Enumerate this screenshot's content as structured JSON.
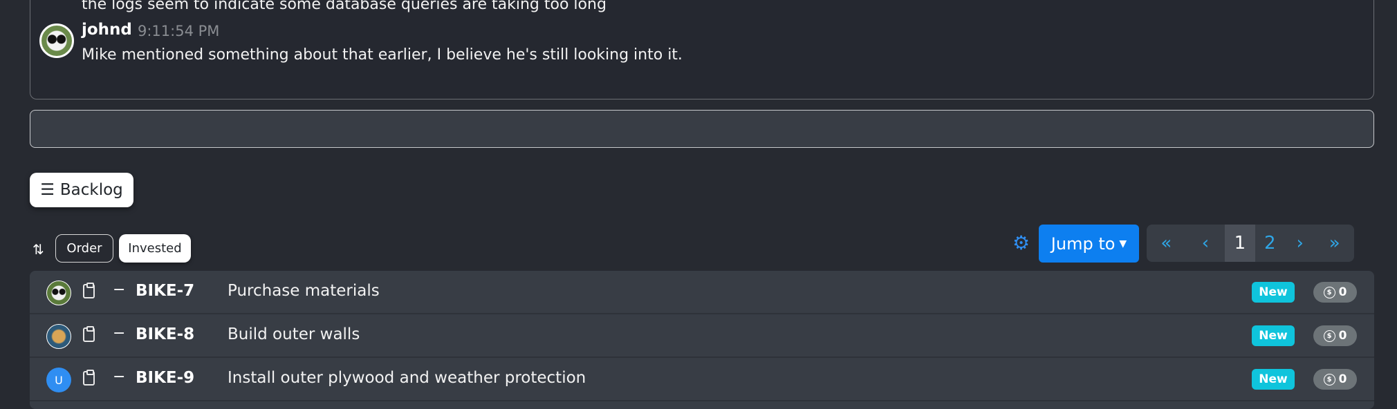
{
  "chat": {
    "previous_message": "the logs seem to indicate some database queries are taking too long",
    "messages": [
      {
        "author": "johnd",
        "time": "9:11:54 PM",
        "text": "Mike mentioned something about that earlier, I believe he's still looking into it."
      }
    ],
    "input_value": ""
  },
  "backlog": {
    "button_label": "Backlog",
    "icon": "list-icon"
  },
  "sort": {
    "icon": "sort-arrows-icon",
    "options": [
      "Order",
      "Invested"
    ],
    "selected": "Invested"
  },
  "toolbar": {
    "settings_icon": "gear-icon",
    "jump_label": "Jump to",
    "pagination": {
      "first": "«",
      "prev": "‹",
      "pages": [
        "1",
        "2"
      ],
      "current": "1",
      "next": "›",
      "last": "»"
    }
  },
  "items": [
    {
      "key": "BIKE-7",
      "title": "Purchase materials",
      "status": "New",
      "invested": "0",
      "priority": "−",
      "avatar": "panda"
    },
    {
      "key": "BIKE-8",
      "title": "Build outer walls",
      "status": "New",
      "invested": "0",
      "priority": "−",
      "avatar": "dog"
    },
    {
      "key": "BIKE-9",
      "title": "Install outer plywood and weather protection",
      "status": "New",
      "invested": "0",
      "priority": "−",
      "avatar": "U"
    }
  ],
  "colors": {
    "accent": "#0d7ff0",
    "status_new": "#0fc4dc",
    "invested_badge": "#6d7478",
    "background": "#272a31"
  }
}
